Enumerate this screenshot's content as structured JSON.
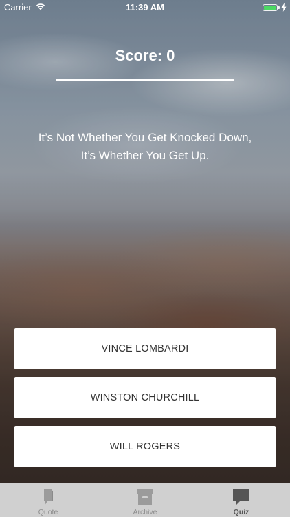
{
  "status_bar": {
    "carrier": "Carrier",
    "time": "11:39 AM",
    "battery_color": "#4cd964"
  },
  "quiz": {
    "score_text": "Score: 0",
    "quote": "It’s Not Whether You Get Knocked Down, It’s Whether You Get Up.",
    "answers": [
      "VINCE LOMBARDI",
      "WINSTON CHURCHILL",
      "WILL ROGERS"
    ]
  },
  "tab_bar": {
    "tabs": [
      {
        "label": "Quote",
        "icon": "quote-icon",
        "active": false
      },
      {
        "label": "Archive",
        "icon": "archive-icon",
        "active": false
      },
      {
        "label": "Quiz",
        "icon": "chat-bubble-icon",
        "active": true
      }
    ]
  }
}
